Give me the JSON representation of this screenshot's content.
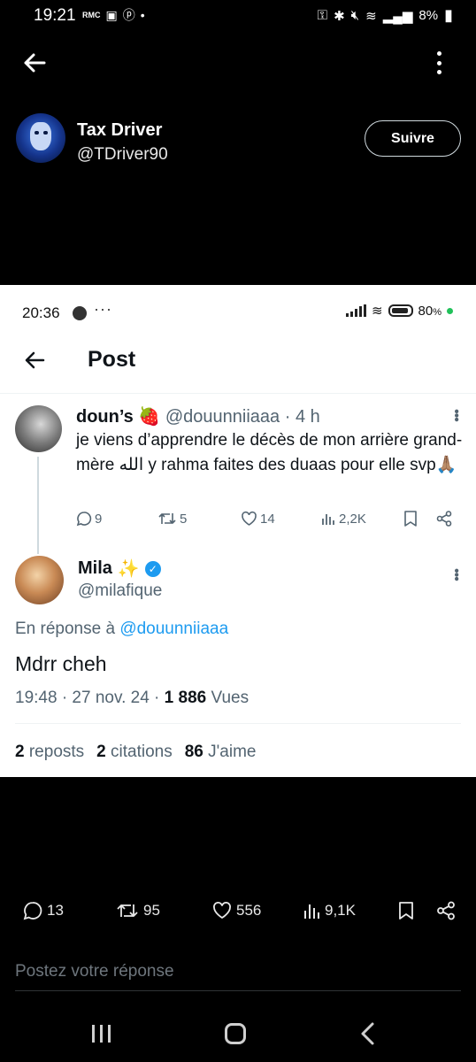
{
  "status_bar": {
    "time": "19:21",
    "rmc": "RMC",
    "battery": "8%"
  },
  "profile": {
    "name": "Tax Driver",
    "handle": "@TDriver90",
    "follow_label": "Suivre"
  },
  "screenshot": {
    "status": {
      "time": "20:36",
      "battery": "80"
    },
    "header": {
      "title": "Post"
    },
    "parent_tweet": {
      "name": "doun’s",
      "name_emoji": "🍓",
      "handle": "@douunniiaaa",
      "sep": "·",
      "time": "4 h",
      "text": "je viens d’apprendre le décès de mon arrière grand-mère الله y rahma faites des duaas pour elle svp🙏🏽",
      "replies": "9",
      "retweets": "5",
      "likes": "14",
      "views": "2,2K"
    },
    "reply_tweet": {
      "name": "Mila",
      "name_emoji": "✨",
      "handle": "@milafique",
      "reply_prefix": "En réponse à",
      "reply_mention": "@douunniiaaa",
      "text": "Mdrr cheh",
      "date": "19:48 · 27 nov. 24 ·",
      "views_count": "1 886",
      "views_label": "Vues",
      "reposts_count": "2",
      "reposts_label": "reposts",
      "quotes_count": "2",
      "quotes_label": "citations",
      "likes_count": "86",
      "likes_label": "J'aime"
    }
  },
  "post_actions": {
    "replies": "13",
    "retweets": "95",
    "likes": "556",
    "views": "9,1K"
  },
  "reply_box": {
    "placeholder": "Postez votre réponse"
  }
}
